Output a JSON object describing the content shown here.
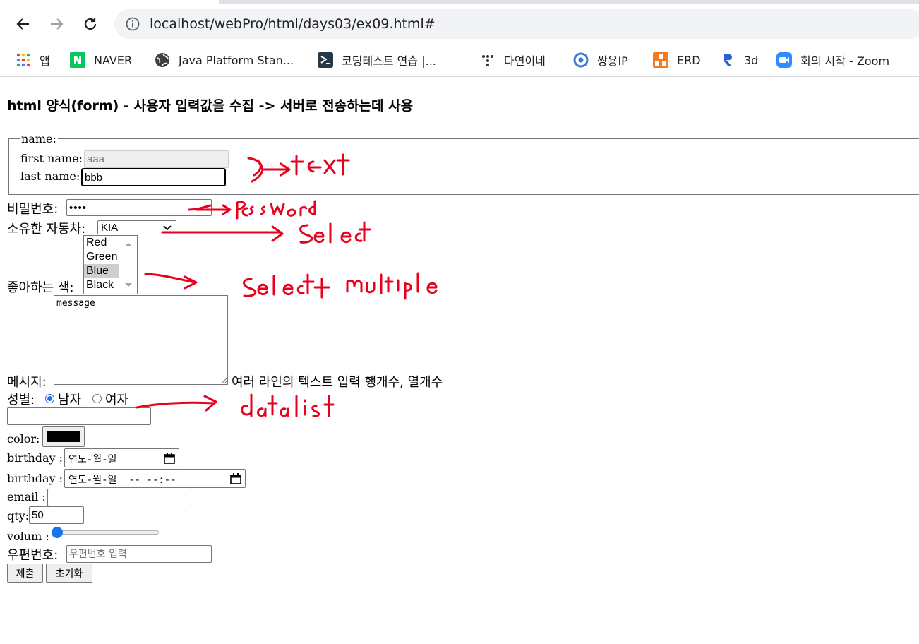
{
  "browser": {
    "url": "localhost/webPro/html/days03/ex09.html#",
    "bookmarks": [
      {
        "label": "앱",
        "icon": "apps-grid-icon"
      },
      {
        "label": "NAVER",
        "icon": "naver-icon"
      },
      {
        "label": "Java Platform Stan...",
        "icon": "globe-icon"
      },
      {
        "label": "코딩테스트 연습 |...",
        "icon": "programmers-icon"
      },
      {
        "label": "다연이네",
        "icon": "dots-icon"
      },
      {
        "label": "쌍용IP",
        "icon": "ring-icon"
      },
      {
        "label": "ERD",
        "icon": "erd-icon"
      },
      {
        "label": "3d",
        "icon": "r-logo-icon"
      },
      {
        "label": "회의 시작 - Zoom",
        "icon": "zoom-icon"
      }
    ]
  },
  "page": {
    "heading": "html 양식(form) - 사용자 입력값을 수집 -> 서버로 전송하는데 사용",
    "fieldset": {
      "legend": "name:",
      "first_name_label": "first name:",
      "first_name_value": "aaa",
      "last_name_label": "last name:",
      "last_name_value": "bbb"
    },
    "password": {
      "label": "비밀번호:",
      "masked_value": "••••"
    },
    "car": {
      "label": "소유한 자동차:",
      "selected": "KIA"
    },
    "colors": {
      "label": "좋아하는 색:",
      "options": [
        "Red",
        "Green",
        "Blue",
        "Black"
      ],
      "selected": "Blue"
    },
    "message": {
      "label": "메시지:",
      "value": "message",
      "note": "여러 라인의 텍스트 입력 행개수, 열개수"
    },
    "gender": {
      "label": "성별:",
      "male": "남자",
      "female": "여자",
      "checked": "남자"
    },
    "color_picker": {
      "label": "color:",
      "value": "#000000"
    },
    "birthday_date": {
      "label": "birthday :",
      "value": "연도-월-일"
    },
    "birthday_datetime": {
      "label": "birthday :",
      "value": "연도-월-일  -- --:--"
    },
    "email": {
      "label": "email :"
    },
    "qty": {
      "label": "qty:",
      "value": "50"
    },
    "volume": {
      "label": "volum :",
      "level_percent": 0
    },
    "zipcode": {
      "label": "우편번호:",
      "placeholder": "우편번호 입력"
    },
    "buttons": {
      "submit": "제출",
      "reset": "초기화"
    },
    "annotations": [
      "text",
      "password",
      "select",
      "select+multiple",
      "datalist"
    ]
  },
  "colors": {
    "annotation_red": "#e8001c",
    "radio_blue": "#1a73e8",
    "omnibox_bg": "#f1f3f4"
  }
}
